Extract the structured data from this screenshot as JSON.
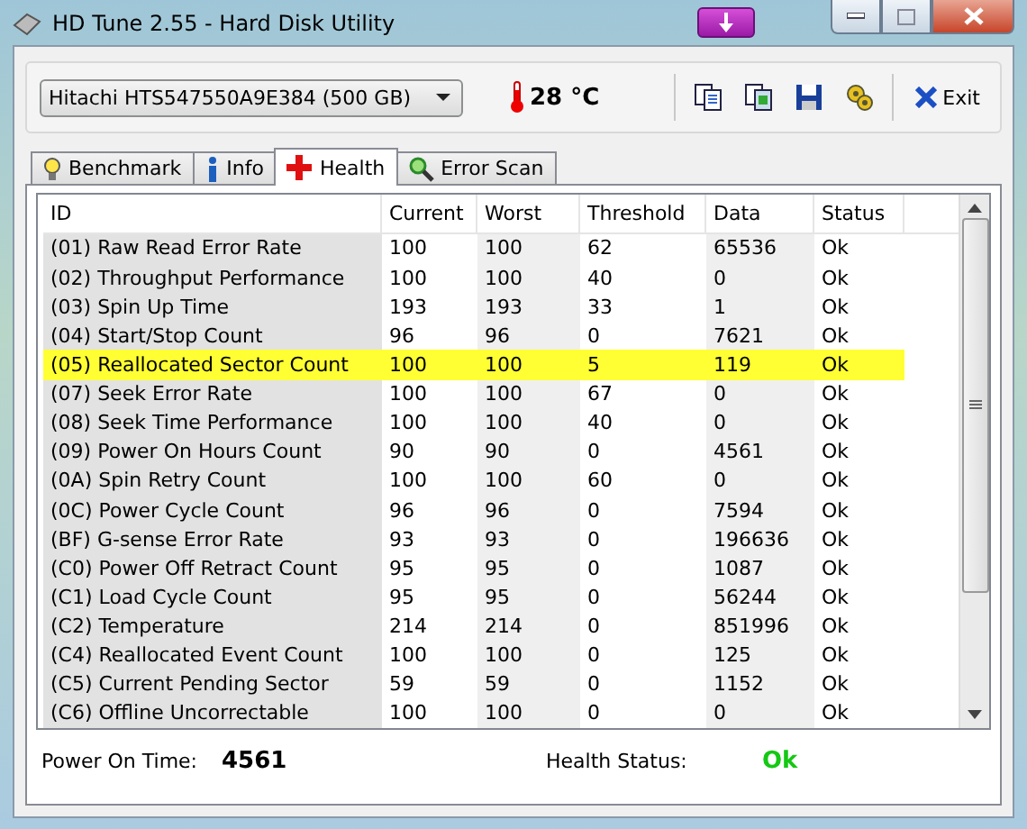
{
  "window": {
    "title": "HD Tune 2.55 - Hard Disk Utility"
  },
  "toolbar": {
    "drive": "Hitachi HTS547550A9E384 (500 GB)",
    "temperature": "28 °C",
    "exit_label": "Exit"
  },
  "tabs": [
    {
      "label": "Benchmark",
      "kind": "bulb",
      "selected": false
    },
    {
      "label": "Info",
      "kind": "info",
      "selected": false
    },
    {
      "label": "Health",
      "kind": "cross",
      "selected": true
    },
    {
      "label": "Error Scan",
      "kind": "magnifier",
      "selected": false
    }
  ],
  "table": {
    "columns": [
      "ID",
      "Current",
      "Worst",
      "Threshold",
      "Data",
      "Status"
    ],
    "rows": [
      {
        "cells": [
          "(01) Raw Read Error Rate",
          "100",
          "100",
          "62",
          "65536",
          "Ok"
        ],
        "highlighted": false
      },
      {
        "cells": [
          "(02) Throughput Performance",
          "100",
          "100",
          "40",
          "0",
          "Ok"
        ],
        "highlighted": false
      },
      {
        "cells": [
          "(03) Spin Up Time",
          "193",
          "193",
          "33",
          "1",
          "Ok"
        ],
        "highlighted": false
      },
      {
        "cells": [
          "(04) Start/Stop Count",
          "96",
          "96",
          "0",
          "7621",
          "Ok"
        ],
        "highlighted": false
      },
      {
        "cells": [
          "(05) Reallocated Sector Count",
          "100",
          "100",
          "5",
          "119",
          "Ok"
        ],
        "highlighted": true
      },
      {
        "cells": [
          "(07) Seek Error Rate",
          "100",
          "100",
          "67",
          "0",
          "Ok"
        ],
        "highlighted": false
      },
      {
        "cells": [
          "(08) Seek Time Performance",
          "100",
          "100",
          "40",
          "0",
          "Ok"
        ],
        "highlighted": false
      },
      {
        "cells": [
          "(09) Power On Hours Count",
          "90",
          "90",
          "0",
          "4561",
          "Ok"
        ],
        "highlighted": false
      },
      {
        "cells": [
          "(0A) Spin Retry Count",
          "100",
          "100",
          "60",
          "0",
          "Ok"
        ],
        "highlighted": false
      },
      {
        "cells": [
          "(0C) Power Cycle Count",
          "96",
          "96",
          "0",
          "7594",
          "Ok"
        ],
        "highlighted": false
      },
      {
        "cells": [
          "(BF) G-sense Error Rate",
          "93",
          "93",
          "0",
          "196636",
          "Ok"
        ],
        "highlighted": false
      },
      {
        "cells": [
          "(C0) Power Off Retract Count",
          "95",
          "95",
          "0",
          "1087",
          "Ok"
        ],
        "highlighted": false
      },
      {
        "cells": [
          "(C1) Load Cycle Count",
          "95",
          "95",
          "0",
          "56244",
          "Ok"
        ],
        "highlighted": false
      },
      {
        "cells": [
          "(C2) Temperature",
          "214",
          "214",
          "0",
          "851996",
          "Ok"
        ],
        "highlighted": false
      },
      {
        "cells": [
          "(C4) Reallocated Event Count",
          "100",
          "100",
          "0",
          "125",
          "Ok"
        ],
        "highlighted": false
      },
      {
        "cells": [
          "(C5) Current Pending Sector",
          "59",
          "59",
          "0",
          "1152",
          "Ok"
        ],
        "highlighted": false
      },
      {
        "cells": [
          "(C6) Offline Uncorrectable",
          "100",
          "100",
          "0",
          "0",
          "Ok"
        ],
        "highlighted": false
      }
    ]
  },
  "footer": {
    "power_on_label": "Power On Time:",
    "power_on_value": "4561",
    "health_label": "Health Status:",
    "health_value": "Ok"
  }
}
